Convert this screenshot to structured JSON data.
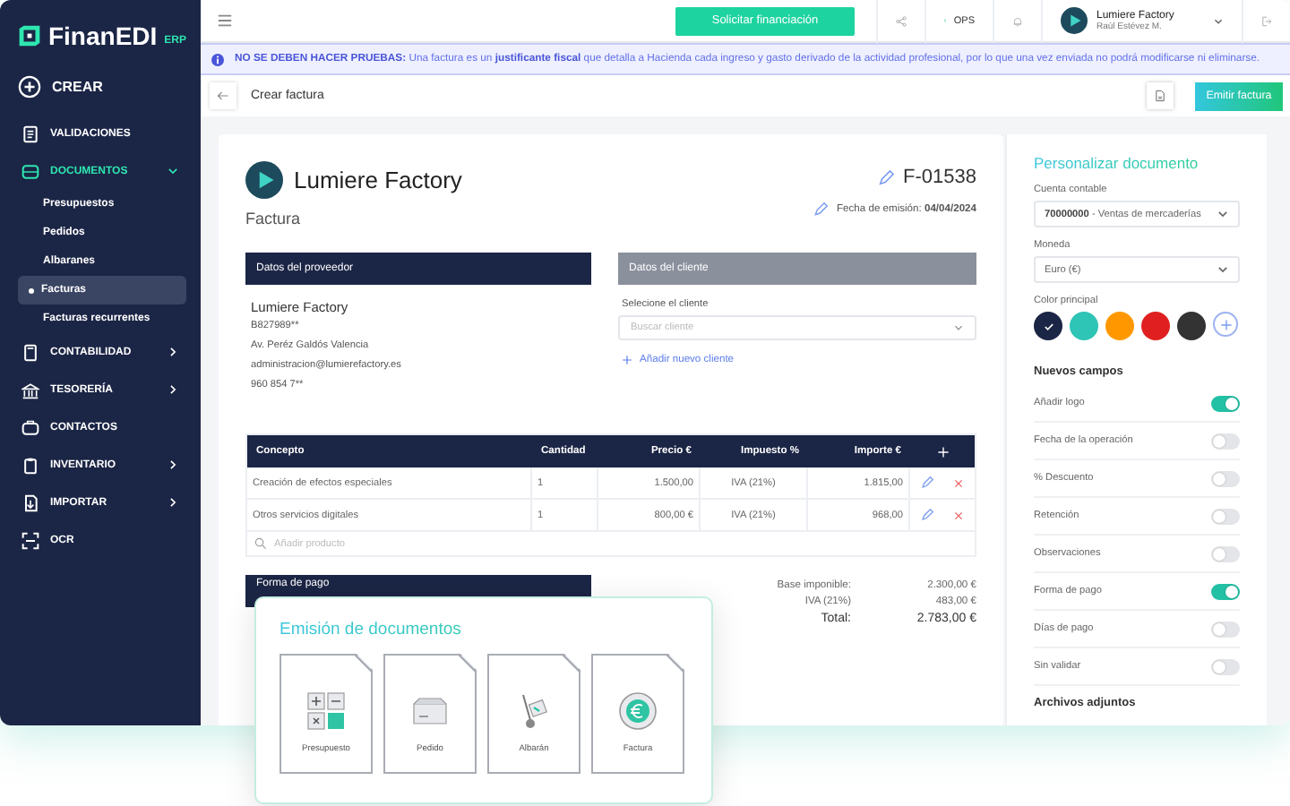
{
  "sidebar": {
    "logo": {
      "name": "FinanEDI",
      "suffix": "ERP"
    },
    "create": "CREAR",
    "items": [
      {
        "label": "VALIDACIONES",
        "kind": "link",
        "selected": false
      },
      {
        "label": "DOCUMENTOS",
        "kind": "menu",
        "expanded": true,
        "selected": true,
        "children": [
          {
            "label": "Presupuestos",
            "selected": false
          },
          {
            "label": "Pedidos",
            "selected": false
          },
          {
            "label": "Albaranes",
            "selected": false
          },
          {
            "label": "Facturas",
            "selected": true
          },
          {
            "label": "Facturas recurrentes",
            "selected": false
          }
        ]
      },
      {
        "label": "CONTABILIDAD",
        "kind": "menu",
        "expanded": false,
        "selected": false
      },
      {
        "label": "TESORERÍA",
        "kind": "menu",
        "expanded": false,
        "selected": false
      },
      {
        "label": "CONTACTOS",
        "kind": "link",
        "selected": false
      },
      {
        "label": "INVENTARIO",
        "kind": "menu",
        "expanded": false,
        "selected": false
      },
      {
        "label": "IMPORTAR",
        "kind": "menu",
        "expanded": false,
        "selected": false
      },
      {
        "label": "OCR",
        "kind": "link",
        "selected": false
      }
    ]
  },
  "topbar": {
    "finance_button": "Solicitar financiación",
    "ops": "OPS",
    "profile": {
      "company": "Lumiere Factory",
      "user": "Raúl Estévez M."
    }
  },
  "banner": "**NO SE DEBEN HACER PRUEBAS:** Una factura es un **justificante fiscal** que detalla a Hacienda cada ingreso y gasto derivado de la actividad profesional, por lo que una vez enviada no podrá modificarse ni eliminarse.",
  "page_header": {
    "title": "Crear factura",
    "emit_button": "Emitir factura"
  },
  "invoice": {
    "company": "Lumiere Factory",
    "doc_type": "Factura",
    "number": "F-01538",
    "date": "Fecha de emisión: **04/04/2024**",
    "provider": {
      "header": "Datos del proveedor",
      "name": "Lumiere Factory",
      "lines": [
        "B827989**",
        "Av. Peréz Galdós  Valencia",
        "administracion@lumierefactory.es",
        "960 854 7**"
      ]
    },
    "client": {
      "header": "Datos del cliente",
      "label": "Selecione el cliente",
      "placeholder": "Buscar  cliente",
      "add_link": "Añadir nuevo cliente"
    },
    "table": {
      "columns": [
        "Concepto",
        "Cantidad",
        "Precio €",
        "Impuesto %",
        "Importe €"
      ],
      "rows": [
        [
          "Creación de efectos especiales",
          "1",
          "1.500,00",
          "IVA (21%)",
          "1.815,00"
        ],
        [
          "Otros servicios digitales",
          "1",
          "800,00 €",
          "IVA (21%)",
          "968,00"
        ]
      ],
      "add_placeholder": "Añadir producto"
    },
    "payment_header": "Forma de pago",
    "totals": [
      {
        "label": "Base imponible:",
        "value": "2.300,00 €",
        "kind": "line"
      },
      {
        "label": "IVA (21%)",
        "value": "483,00 €",
        "kind": "line"
      },
      {
        "label": "Total:",
        "value": "2.783,00 €",
        "kind": "total"
      }
    ]
  },
  "customize": {
    "title": "Personalizar documento",
    "account_label": "Cuenta contable",
    "account_value": "**70000000** - Ventas de mercaderías",
    "currency_label": "Moneda",
    "currency_value": "Euro (€)",
    "color_label": "Color principal",
    "colors": [
      {
        "color": "#1b2545",
        "selected": true
      },
      {
        "color": "#2ec4b6",
        "selected": false
      },
      {
        "color": "#ff9800",
        "selected": false
      },
      {
        "color": "#e02020",
        "selected": false
      },
      {
        "color": "#333333",
        "selected": false
      }
    ],
    "fields_title": "Nuevos campos",
    "fields": [
      {
        "label": "Añadir logo",
        "on": true
      },
      {
        "label": "Fecha de la operación",
        "on": false
      },
      {
        "label": "% Descuento",
        "on": false
      },
      {
        "label": "Retención",
        "on": false
      },
      {
        "label": "Observaciones",
        "on": false
      },
      {
        "label": "Forma de pago",
        "on": true
      },
      {
        "label": "Días de pago",
        "on": false
      },
      {
        "label": "Sin validar",
        "on": false
      }
    ],
    "attachments_title": "Archivos adjuntos"
  },
  "popup": {
    "title": "Emisión de documentos",
    "documents": [
      {
        "label": "Presupuesto",
        "kind": "quote"
      },
      {
        "label": "Pedido",
        "kind": "order"
      },
      {
        "label": "Albarán",
        "kind": "delivery"
      },
      {
        "label": "Factura",
        "kind": "invoice"
      }
    ]
  }
}
